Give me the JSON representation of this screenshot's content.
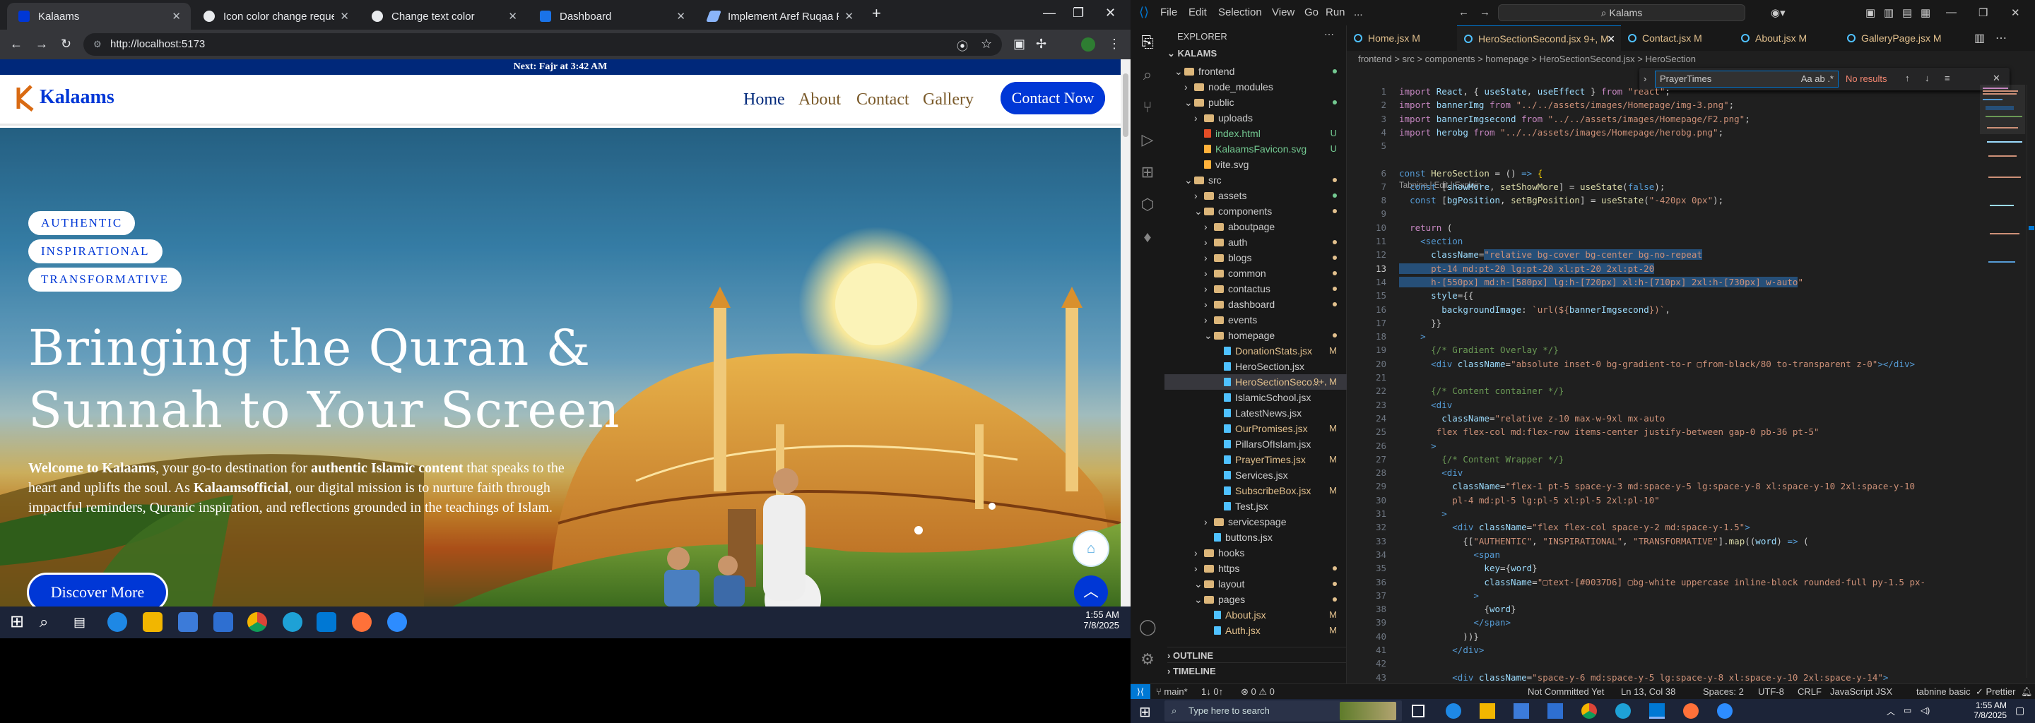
{
  "browser": {
    "tabs": [
      {
        "label": "Kalaams",
        "active": true
      },
      {
        "label": "Icon color change request",
        "active": false
      },
      {
        "label": "Change text color",
        "active": false
      },
      {
        "label": "Dashboard",
        "active": false
      },
      {
        "label": "Implement Aref Ruqaa Font in R",
        "active": false
      }
    ],
    "new_tab": "+",
    "url": "http://localhost:5173"
  },
  "site": {
    "announcement": "Next: Fajr at 3:42 AM",
    "logo": "Kalaams",
    "nav": [
      "Home",
      "About",
      "Contact",
      "Gallery"
    ],
    "cta": "Contact Now",
    "pills": [
      "AUTHENTIC",
      "INSPIRATIONAL",
      "TRANSFORMATIVE"
    ],
    "heading_line1": "Bringing the Quran &",
    "heading_line2": "Sunnah to Your Screen",
    "desc_bold1": "Welcome to Kalaams",
    "desc_part1": ", your go-to destination for ",
    "desc_bold2": "authentic Islamic content",
    "desc_part2": " that speaks to the heart and uplifts the soul. As ",
    "desc_bold3": "Kalaamsofficial",
    "desc_part3": ", our digital mission is to nurture faith through impactful reminders, Quranic inspiration, and reflections grounded in the teachings of Islam.",
    "discover": "Discover More"
  },
  "left_taskbar": {
    "time": "1:55 AM",
    "date": "7/8/2025"
  },
  "vscode": {
    "menus": [
      "File",
      "Edit",
      "Selection",
      "View",
      "Go",
      "Run",
      "..."
    ],
    "search": "Kalams",
    "explorer_title": "EXPLORER",
    "root": "KALAMS",
    "tree": [
      {
        "label": "frontend",
        "depth": 1,
        "type": "open",
        "mark": "dot-green"
      },
      {
        "label": "node_modules",
        "depth": 2,
        "type": "closed",
        "mark": ""
      },
      {
        "label": "public",
        "depth": 2,
        "type": "open",
        "mark": "dot-green"
      },
      {
        "label": "uploads",
        "depth": 3,
        "type": "closed",
        "mark": ""
      },
      {
        "label": "index.html",
        "depth": 3,
        "type": "file",
        "mark": "U"
      },
      {
        "label": "KalaamsFavicon.svg",
        "depth": 3,
        "type": "file",
        "mark": "U"
      },
      {
        "label": "vite.svg",
        "depth": 3,
        "type": "file",
        "mark": ""
      },
      {
        "label": "src",
        "depth": 2,
        "type": "open",
        "mark": "dot-amber"
      },
      {
        "label": "assets",
        "depth": 3,
        "type": "closed",
        "mark": "dot-green"
      },
      {
        "label": "components",
        "depth": 3,
        "type": "open",
        "mark": "dot-amber"
      },
      {
        "label": "aboutpage",
        "depth": 4,
        "type": "closed",
        "mark": ""
      },
      {
        "label": "auth",
        "depth": 4,
        "type": "closed",
        "mark": "dot-amber"
      },
      {
        "label": "blogs",
        "depth": 4,
        "type": "closed",
        "mark": "dot-amber"
      },
      {
        "label": "common",
        "depth": 4,
        "type": "closed",
        "mark": "dot-amber"
      },
      {
        "label": "contactus",
        "depth": 4,
        "type": "closed",
        "mark": "dot-amber"
      },
      {
        "label": "dashboard",
        "depth": 4,
        "type": "closed",
        "mark": "dot-amber"
      },
      {
        "label": "events",
        "depth": 4,
        "type": "closed",
        "mark": ""
      },
      {
        "label": "homepage",
        "depth": 4,
        "type": "open",
        "mark": "dot-amber"
      },
      {
        "label": "DonationStats.jsx",
        "depth": 5,
        "type": "file",
        "mark": "M"
      },
      {
        "label": "HeroSection.jsx",
        "depth": 5,
        "type": "file",
        "mark": ""
      },
      {
        "label": "HeroSectionSeco...",
        "depth": 5,
        "type": "file",
        "mark": "9+, M",
        "selected": true
      },
      {
        "label": "IslamicSchool.jsx",
        "depth": 5,
        "type": "file",
        "mark": ""
      },
      {
        "label": "LatestNews.jsx",
        "depth": 5,
        "type": "file",
        "mark": ""
      },
      {
        "label": "OurPromises.jsx",
        "depth": 5,
        "type": "file",
        "mark": "M"
      },
      {
        "label": "PillarsOfIslam.jsx",
        "depth": 5,
        "type": "file",
        "mark": ""
      },
      {
        "label": "PrayerTimes.jsx",
        "depth": 5,
        "type": "file",
        "mark": "M"
      },
      {
        "label": "Services.jsx",
        "depth": 5,
        "type": "file",
        "mark": ""
      },
      {
        "label": "SubscribeBox.jsx",
        "depth": 5,
        "type": "file",
        "mark": "M"
      },
      {
        "label": "Test.jsx",
        "depth": 5,
        "type": "file",
        "mark": ""
      },
      {
        "label": "servicespage",
        "depth": 4,
        "type": "closed",
        "mark": ""
      },
      {
        "label": "buttons.jsx",
        "depth": 4,
        "type": "file",
        "mark": ""
      },
      {
        "label": "hooks",
        "depth": 3,
        "type": "closed",
        "mark": ""
      },
      {
        "label": "https",
        "depth": 3,
        "type": "closed",
        "mark": "dot-amber"
      },
      {
        "label": "layout",
        "depth": 3,
        "type": "open",
        "mark": "dot-amber"
      },
      {
        "label": "pages",
        "depth": 3,
        "type": "open",
        "mark": "dot-amber"
      },
      {
        "label": "About.jsx",
        "depth": 4,
        "type": "file",
        "mark": "M"
      },
      {
        "label": "Auth.jsx",
        "depth": 4,
        "type": "file",
        "mark": "M"
      }
    ],
    "outline": "OUTLINE",
    "timeline": "TIMELINE",
    "editor_tabs": [
      {
        "label": "Home.jsx M",
        "active": false
      },
      {
        "label": "HeroSectionSecond.jsx 9+, M",
        "active": true
      },
      {
        "label": "Contact.jsx M",
        "active": false
      },
      {
        "label": "About.jsx M",
        "active": false
      },
      {
        "label": "GalleryPage.jsx M",
        "active": false
      }
    ],
    "breadcrumb": "frontend > src > components > homepage > HeroSectionSecond.jsx > HeroSection",
    "find": {
      "query": "PrayerTimes",
      "result": "No results"
    },
    "codelens": "Tabnine | Edit | Explain",
    "code": [
      {
        "n": "1",
        "html": "<span class=k>import</span> <span class=v>React</span>, { <span class=v>useState</span>, <span class=v>useEffect</span> } <span class=k>from</span> <span class=s>\"react\"</span>;"
      },
      {
        "n": "2",
        "html": "<span class=k>import</span> <span class=v>bannerImg</span> <span class=k>from</span> <span class=s>\"../../assets/images/Homepage/img-3.png\"</span>;"
      },
      {
        "n": "3",
        "html": "<span class=k>import</span> <span class=v>bannerImgsecond</span> <span class=k>from</span> <span class=s>\"../../assets/images/Homepage/F2.png\"</span>;"
      },
      {
        "n": "4",
        "html": "<span class=k>import</span> <span class=v>herobg</span> <span class=k>from</span> <span class=s>\"../../assets/images/Homepage/herobg.png\"</span>;"
      },
      {
        "n": "5",
        "html": ""
      },
      {
        "n": "6",
        "html": "<span class=p>const</span> <span class=f>HeroSection</span> = () <span class=p>=></span> <span class=b>{</span>"
      },
      {
        "n": "7",
        "html": "  <span class=p>const</span> [<span class=v>showMore</span>, <span class=f>setShowMore</span>] = <span class=f>useState</span>(<span class=p>false</span>);"
      },
      {
        "n": "8",
        "html": "  <span class=p>const</span> [<span class=v>bgPosition</span>, <span class=f>setBgPosition</span>] = <span class=f>useState</span>(<span class=s>\"-420px 0px\"</span>);"
      },
      {
        "n": "9",
        "html": ""
      },
      {
        "n": "10",
        "html": "  <span class=k>return</span> ("
      },
      {
        "n": "11",
        "html": "    <span class=p>&lt;</span><span class=p>section</span>"
      },
      {
        "n": "12",
        "html": "      <span class=v>className</span>=<span class='s h'>\"relative bg-cover bg-center bg-no-repeat</span>"
      },
      {
        "n": "13",
        "html": "<span class='s h'>      pt-14 md:pt-20 lg:pt-20 xl:pt-20 2xl:pt-20</span>"
      },
      {
        "n": "14",
        "html": "<span class='s h'>      h-[550px] md:h-[580px] lg:h-[720px] xl:h-[710px] 2xl:h-[730px] w-auto</span><span class=s>\"</span>"
      },
      {
        "n": "15",
        "html": "      <span class=v>style</span>={{"
      },
      {
        "n": "16",
        "html": "        <span class=v>backgroundImage</span>: <span class=s>`url(${</span><span class=v>bannerImgsecond</span><span class=s>})`</span>,"
      },
      {
        "n": "17",
        "html": "      }}"
      },
      {
        "n": "18",
        "html": "    <span class=p>&gt;</span>"
      },
      {
        "n": "19",
        "html": "      <span class=c>{/* Gradient Overlay */}</span>"
      },
      {
        "n": "20",
        "html": "      <span class=p>&lt;div</span> <span class=v>className</span>=<span class=s>\"absolute inset-0 bg-gradient-to-r ▢from-black/80 to-transparent z-0\"</span><span class=p>&gt;&lt;/div&gt;</span>"
      },
      {
        "n": "21",
        "html": ""
      },
      {
        "n": "22",
        "html": "      <span class=c>{/* Content container */}</span>"
      },
      {
        "n": "23",
        "html": "      <span class=p>&lt;div</span>"
      },
      {
        "n": "24",
        "html": "        <span class=v>className</span>=<span class=s>\"relative z-10 max-w-9xl mx-auto</span>"
      },
      {
        "n": "25",
        "html": "<span class=s>       flex flex-col md:flex-row items-center justify-between gap-0 pb-36 pt-5\"</span>"
      },
      {
        "n": "26",
        "html": "      <span class=p>&gt;</span>"
      },
      {
        "n": "27",
        "html": "        <span class=c>{/* Content Wrapper */}</span>"
      },
      {
        "n": "28",
        "html": "        <span class=p>&lt;div</span>"
      },
      {
        "n": "29",
        "html": "          <span class=v>className</span>=<span class=s>\"flex-1 pt-5 space-y-3 md:space-y-5 lg:space-y-8 xl:space-y-10 2xl:space-y-10</span>"
      },
      {
        "n": "30",
        "html": "<span class=s>          pl-4 md:pl-5 lg:pl-5 xl:pl-5 2xl:pl-10\"</span>"
      },
      {
        "n": "31",
        "html": "        <span class=p>&gt;</span>"
      },
      {
        "n": "32",
        "html": "          <span class=p>&lt;div</span> <span class=v>className</span>=<span class=s>\"flex flex-col space-y-2 md:space-y-1.5\"</span><span class=p>&gt;</span>"
      },
      {
        "n": "33",
        "html": "            {[<span class=s>\"AUTHENTIC\"</span>, <span class=s>\"INSPIRATIONAL\"</span>, <span class=s>\"TRANSFORMATIVE\"</span>].<span class=f>map</span>((<span class=v>word</span>) <span class=p>=></span> ("
      },
      {
        "n": "34",
        "html": "              <span class=p>&lt;span</span>"
      },
      {
        "n": "35",
        "html": "                <span class=v>key</span>={<span class=v>word</span>}"
      },
      {
        "n": "36",
        "html": "                <span class=v>className</span>=<span class=s>\"▢text-[#0037D6] ▢bg-white uppercase inline-block rounded-full py-1.5 px-</span>"
      },
      {
        "n": "37",
        "html": "              <span class=p>&gt;</span>"
      },
      {
        "n": "38",
        "html": "                {<span class=v>word</span>}"
      },
      {
        "n": "39",
        "html": "              <span class=p>&lt;/span&gt;</span>"
      },
      {
        "n": "40",
        "html": "            ))}"
      },
      {
        "n": "41",
        "html": "          <span class=p>&lt;/div&gt;</span>"
      },
      {
        "n": "42",
        "html": ""
      },
      {
        "n": "43",
        "html": "          <span class=p>&lt;div</span> <span class=v>className</span>=<span class=s>\"space-y-6 md:space-y-5 lg:space-y-8 xl:space-y-10 2xl:space-y-14\"</span><span class=p>&gt;</span>"
      }
    ],
    "status": {
      "branch": "main*",
      "sync": "1↓ 0↑",
      "problems": "⊗ 0 ⚠ 0",
      "center": "Not Committed Yet",
      "position": "Ln 13, Col 38",
      "spaces": "Spaces: 2",
      "encoding": "UTF-8",
      "eol": "CRLF",
      "lang": "JavaScript JSX",
      "tabnine": "tabnine basic",
      "prettier": "✓ Prettier"
    },
    "taskbar": {
      "search": "Type here to search",
      "time": "1:55 AM",
      "date": "7/8/2025"
    }
  },
  "colors": {
    "brand": "#0037D6",
    "announce": "#00287A",
    "accent": "#0078D4"
  }
}
